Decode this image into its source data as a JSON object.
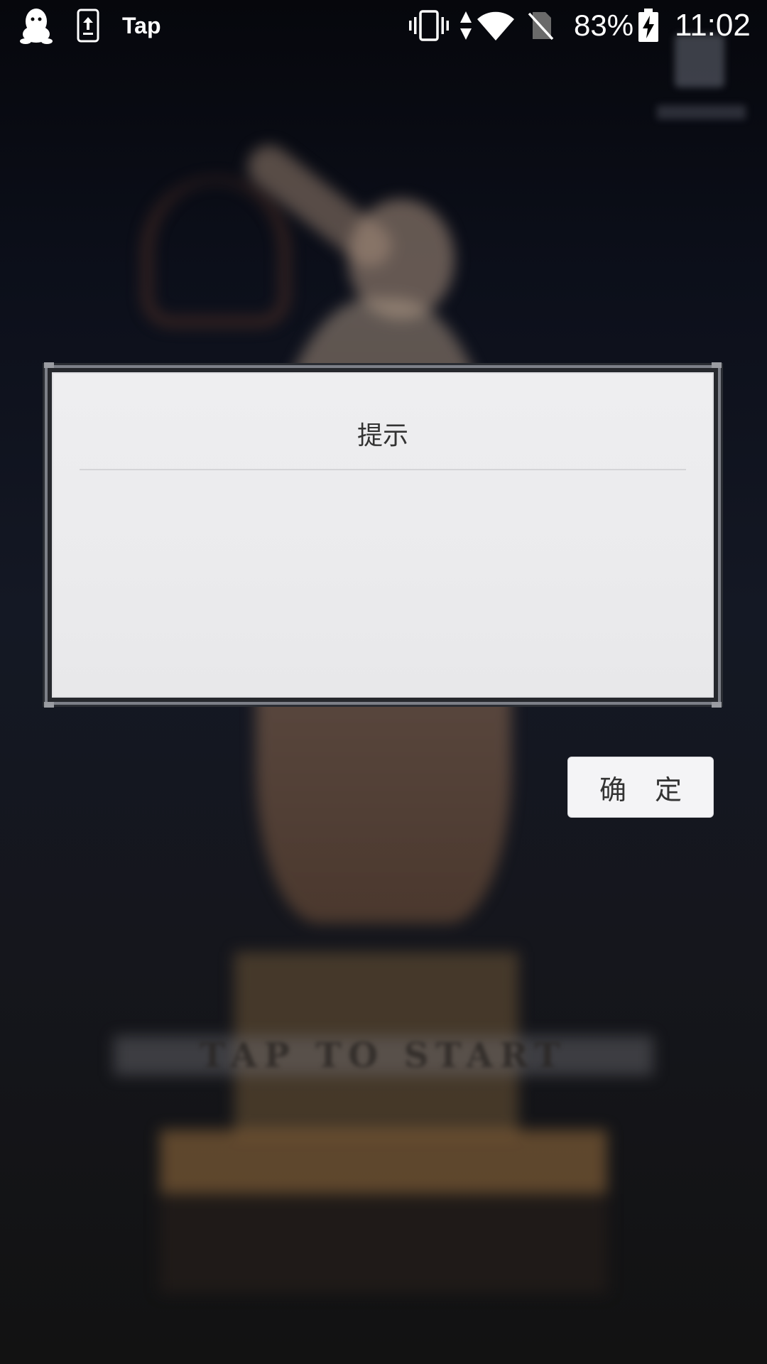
{
  "status_bar": {
    "app_label": "Tap",
    "battery_percent": "83%",
    "clock": "11:02",
    "icons": [
      "qq-penguin-icon",
      "upload-phone-icon",
      "vibrate-icon",
      "data-arrows-icon",
      "wifi-icon",
      "no-sim-icon",
      "battery-charging-icon"
    ]
  },
  "background": {
    "start_prompt": "TAP TO START"
  },
  "dialog": {
    "title": "提示",
    "message": "",
    "confirm_label": "确 定"
  }
}
